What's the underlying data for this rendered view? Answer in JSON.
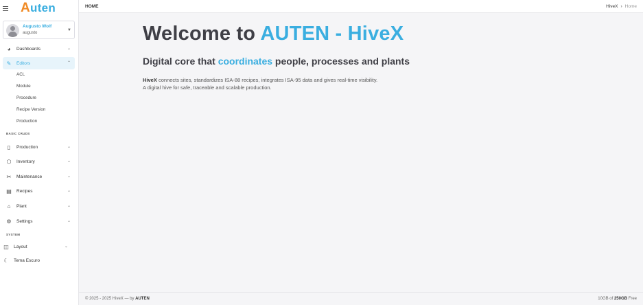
{
  "logo": {
    "first": "A",
    "rest": "uten"
  },
  "user": {
    "name": "Augusto Wolf",
    "login": "augusto"
  },
  "sidebar": {
    "dashboards": "Dashboards",
    "editors": "Editors",
    "editors_sub": [
      "ACL",
      "Module",
      "Procedure",
      "Recipe Version",
      "Production"
    ],
    "section_basic": "BASIC CRUDS",
    "basic_items": [
      "Production",
      "Inventory",
      "Maintenance",
      "Recipes",
      "Plant",
      "Settings"
    ],
    "section_system": "SYSTEM",
    "layout": "Layout",
    "theme": "Tema Escuro"
  },
  "header": {
    "page_title": "HOME",
    "breadcrumb_root": "HiveX",
    "breadcrumb_sep": "›",
    "breadcrumb_current": "Home"
  },
  "main": {
    "welcome_prefix": "Welcome to ",
    "welcome_brand": "AUTEN - HiveX",
    "subtitle_start": "Digital core that ",
    "subtitle_highlight": "coordinates",
    "subtitle_end": " people, processes and plants",
    "desc_brand": "HiveX",
    "desc_line1": " connects sites, standardizes ISA-88 recipes, integrates ISA-95 data and gives real-time visibility.",
    "desc_line2": "A digital hive for safe, traceable and scalable production."
  },
  "footer": {
    "copyright": "© 2025 - 2025 HiveX — by ",
    "company": "AUTEN",
    "storage_used": "10GB",
    "storage_of": " of ",
    "storage_total": "250GB",
    "storage_free": " Free"
  },
  "colors": {
    "accent": "#3aaee0",
    "logo_orange": "#f08a24"
  }
}
